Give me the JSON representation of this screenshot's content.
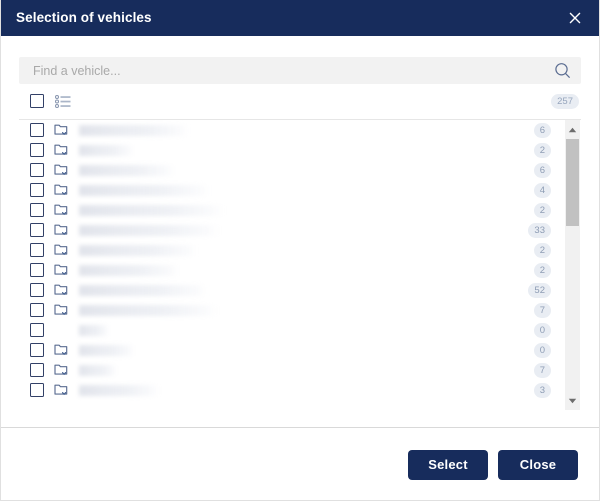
{
  "dialog": {
    "title": "Selection of vehicles",
    "close_icon": "close-icon"
  },
  "search": {
    "placeholder": "Find a vehicle...",
    "value": "",
    "icon": "search-icon"
  },
  "toolbar": {
    "select_all_checked": false,
    "list_view_icon": "list-detail-icon",
    "total_badge": "257"
  },
  "list": {
    "rows": [
      {
        "label": "",
        "label_width": 110,
        "has_folder": true,
        "badge": "6"
      },
      {
        "label": "",
        "label_width": 55,
        "has_folder": true,
        "badge": "2"
      },
      {
        "label": "",
        "label_width": 96,
        "has_folder": true,
        "badge": "6"
      },
      {
        "label": "",
        "label_width": 130,
        "has_folder": true,
        "badge": "4"
      },
      {
        "label": "",
        "label_width": 145,
        "has_folder": true,
        "badge": "2"
      },
      {
        "label": "",
        "label_width": 140,
        "has_folder": true,
        "badge": "33"
      },
      {
        "label": "",
        "label_width": 118,
        "has_folder": true,
        "badge": "2"
      },
      {
        "label": "",
        "label_width": 100,
        "has_folder": true,
        "badge": "2"
      },
      {
        "label": "",
        "label_width": 128,
        "has_folder": true,
        "badge": "52"
      },
      {
        "label": "",
        "label_width": 138,
        "has_folder": true,
        "badge": "7"
      },
      {
        "label": "",
        "label_width": 30,
        "has_folder": false,
        "badge": "0"
      },
      {
        "label": "",
        "label_width": 56,
        "has_folder": true,
        "badge": "0"
      },
      {
        "label": "",
        "label_width": 38,
        "has_folder": true,
        "badge": "7"
      },
      {
        "label": "",
        "label_width": 80,
        "has_folder": true,
        "badge": "3"
      }
    ],
    "scrollbar": {
      "up_icon": "triangle-up-icon",
      "down_icon": "triangle-down-icon"
    }
  },
  "footer": {
    "select_label": "Select",
    "close_label": "Close"
  },
  "colors": {
    "titlebar": "#172c5c",
    "button": "#172c5c",
    "badge_bg": "#e9edf3",
    "badge_text": "#97a6bd",
    "icon_stroke": "#5a6c91",
    "search_bg": "#f2f2f2"
  }
}
